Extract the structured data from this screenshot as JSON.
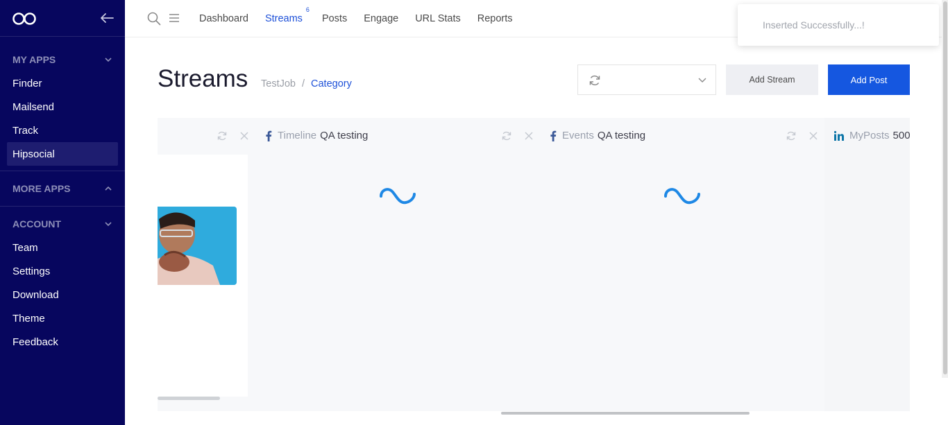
{
  "sidebar": {
    "sections": [
      {
        "title": "MY APPS",
        "items": [
          "Finder",
          "Mailsend",
          "Track",
          "Hipsocial"
        ]
      },
      {
        "title": "MORE APPS",
        "items": []
      },
      {
        "title": "ACCOUNT",
        "items": [
          "Team",
          "Settings",
          "Download",
          "Theme",
          "Feedback"
        ]
      }
    ],
    "active_item": "Hipsocial"
  },
  "topnav": {
    "links": [
      "Dashboard",
      "Streams",
      "Posts",
      "Engage",
      "URL Stats",
      "Reports"
    ],
    "active": "Streams",
    "streams_badge": "6"
  },
  "toast": {
    "message": "Inserted Successfully...!"
  },
  "page": {
    "title": "Streams",
    "breadcrumb": {
      "job": "TestJob",
      "separator": "/",
      "current": "Category"
    },
    "add_stream_label": "Add Stream",
    "add_post_label": "Add Post"
  },
  "streams": [
    {
      "type": "",
      "name": "",
      "source_icon": "none"
    },
    {
      "type": "Timeline",
      "name": "QA testing",
      "source_icon": "facebook-icon"
    },
    {
      "type": "Events",
      "name": "QA testing",
      "source_icon": "facebook-icon"
    },
    {
      "type": "MyPosts",
      "name": "500",
      "source_icon": "linkedin-icon"
    }
  ],
  "colors": {
    "sidebar_bg": "#07065e",
    "accent": "#1d50d8",
    "primary_button": "#1557e0",
    "spinner": "#1e88e5"
  }
}
